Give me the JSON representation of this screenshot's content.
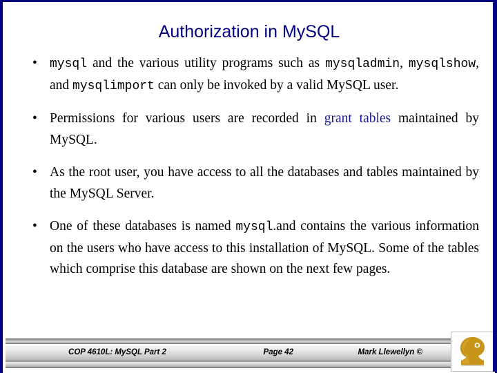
{
  "slide": {
    "title": "Authorization in MySQL",
    "title_color": "#000080",
    "border_color": "#000080",
    "accent_color": "#1a1a8c",
    "background": "#ffffff"
  },
  "bullets": [
    {
      "marker": "•",
      "parts": [
        {
          "text": "mysql",
          "style": "mono"
        },
        {
          "text": " and the various utility programs such as ",
          "style": "plain"
        },
        {
          "text": "mysqladmin",
          "style": "mono"
        },
        {
          "text": ", ",
          "style": "plain"
        },
        {
          "text": "mysqlshow",
          "style": "mono"
        },
        {
          "text": ", and ",
          "style": "plain"
        },
        {
          "text": "mysqlimport",
          "style": "mono"
        },
        {
          "text": " can only be invoked by a valid MySQL user.",
          "style": "plain"
        }
      ]
    },
    {
      "marker": "•",
      "parts": [
        {
          "text": "Permissions for various users are recorded in ",
          "style": "plain"
        },
        {
          "text": "grant tables",
          "style": "accent"
        },
        {
          "text": " maintained by MySQL.",
          "style": "plain"
        }
      ]
    },
    {
      "marker": "•",
      "parts": [
        {
          "text": "As the root user, you have access to all the databases and tables maintained by the MySQL Server.",
          "style": "plain"
        }
      ]
    },
    {
      "marker": "•",
      "parts": [
        {
          "text": "One of these databases is named ",
          "style": "plain"
        },
        {
          "text": "mysql",
          "style": "mono"
        },
        {
          "text": ".and contains the various information on the users who have access to this installation of MySQL.  Some of the tables which comprise this database are shown on the next few pages.",
          "style": "plain"
        }
      ]
    }
  ],
  "footer": {
    "course": "COP 4610L: MySQL Part 2",
    "page": "Page 42",
    "author": "Mark Llewellyn ©"
  },
  "logo": {
    "name": "ucf-pegasus-logo",
    "color": "#c8951b",
    "shadow_color": "#8a6510"
  }
}
